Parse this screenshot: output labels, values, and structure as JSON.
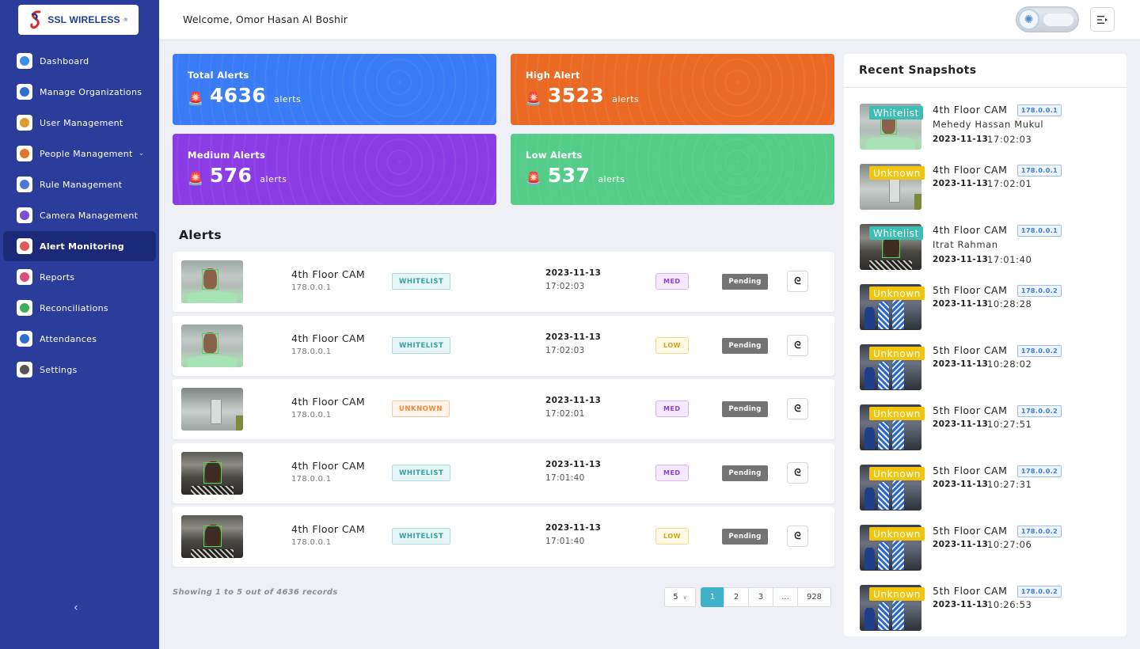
{
  "brand": {
    "logo_text": "SSL WIRELESS",
    "logo_mark": "®"
  },
  "sidebar": {
    "items": [
      {
        "label": "Dashboard",
        "icon": "dashboard-icon",
        "color": "#3a8ee6",
        "active": false
      },
      {
        "label": "Manage Organizations",
        "icon": "building-icon",
        "color": "#2f6fd0",
        "active": false
      },
      {
        "label": "User Management",
        "icon": "user-icon",
        "color": "#e29a2b",
        "active": false
      },
      {
        "label": "People Management",
        "icon": "people-icon",
        "color": "#e0762a",
        "active": false,
        "has_caret": true
      },
      {
        "label": "Rule Management",
        "icon": "rules-icon",
        "color": "#4c79d8",
        "active": false
      },
      {
        "label": "Camera Management",
        "icon": "camera-icon",
        "color": "#7b4fd4",
        "active": false
      },
      {
        "label": "Alert Monitoring",
        "icon": "alert-icon",
        "color": "#e05a5a",
        "active": true
      },
      {
        "label": "Reports",
        "icon": "reports-icon",
        "color": "#d94f7a",
        "active": false
      },
      {
        "label": "Reconciliations",
        "icon": "reconcile-icon",
        "color": "#3fae5a",
        "active": false
      },
      {
        "label": "Attendances",
        "icon": "attendance-icon",
        "color": "#2f6fd0",
        "active": false
      },
      {
        "label": "Settings",
        "icon": "gear-icon",
        "color": "#555555",
        "active": false
      }
    ],
    "collapse_label": "‹"
  },
  "header": {
    "welcome": "Welcome, Omor Hasan Al Boshir",
    "menu_icon": "menu-toggle-icon"
  },
  "stats": [
    {
      "title": "Total Alerts",
      "value": "4636",
      "unit": "alerts",
      "color": "#3a7cf6"
    },
    {
      "title": "High Alert",
      "value": "3523",
      "unit": "alerts",
      "color": "#ea6a25"
    },
    {
      "title": "Medium Alerts",
      "value": "576",
      "unit": "alerts",
      "color": "#8b3ce5"
    },
    {
      "title": "Low Alerts",
      "value": "537",
      "unit": "alerts",
      "color": "#55cc88"
    }
  ],
  "alerts": {
    "title": "Alerts",
    "rows": [
      {
        "camera": "4th Floor CAM",
        "ip": "178.0.0.1",
        "tag": "WHITELIST",
        "date": "2023-11-13",
        "time": "17:02:03",
        "severity": "MED",
        "status": "Pending",
        "thumb": "office"
      },
      {
        "camera": "4th Floor CAM",
        "ip": "178.0.0.1",
        "tag": "WHITELIST",
        "date": "2023-11-13",
        "time": "17:02:03",
        "severity": "LOW",
        "status": "Pending",
        "thumb": "office"
      },
      {
        "camera": "4th Floor CAM",
        "ip": "178.0.0.1",
        "tag": "UNKNOWN",
        "date": "2023-11-13",
        "time": "17:02:01",
        "severity": "MED",
        "status": "Pending",
        "thumb": "wall"
      },
      {
        "camera": "4th Floor CAM",
        "ip": "178.0.0.1",
        "tag": "WHITELIST",
        "date": "2023-11-13",
        "time": "17:01:40",
        "severity": "MED",
        "status": "Pending",
        "thumb": "dark"
      },
      {
        "camera": "4th Floor CAM",
        "ip": "178.0.0.1",
        "tag": "WHITELIST",
        "date": "2023-11-13",
        "time": "17:01:40",
        "severity": "LOW",
        "status": "Pending",
        "thumb": "dark"
      }
    ],
    "action_icon": "detail-icon",
    "records_text": "Showing 1 to 5 out of 4636 records",
    "per_page": "5",
    "pages": [
      "1",
      "2",
      "3",
      "...",
      "928"
    ],
    "current_page": "1"
  },
  "snapshots": {
    "title": "Recent Snapshots",
    "items": [
      {
        "badge": "Whitelist",
        "camera": "4th Floor CAM",
        "ip": "178.0.0.1",
        "person": "Mehedy Hassan Mukul",
        "date": "2023-11-13",
        "time": "17:02:03",
        "thumb": "office"
      },
      {
        "badge": "Unknown",
        "camera": "4th Floor CAM",
        "ip": "178.0.0.1",
        "person": "",
        "date": "2023-11-13",
        "time": "17:02:01",
        "thumb": "wall"
      },
      {
        "badge": "Whitelist",
        "camera": "4th Floor CAM",
        "ip": "178.0.0.1",
        "person": "Itrat Rahman",
        "date": "2023-11-13",
        "time": "17:01:40",
        "thumb": "dark"
      },
      {
        "badge": "Unknown",
        "camera": "5th Floor CAM",
        "ip": "178.0.0.2",
        "person": "",
        "date": "2023-11-13",
        "time": "10:28:28",
        "thumb": "crowd"
      },
      {
        "badge": "Unknown",
        "camera": "5th Floor CAM",
        "ip": "178.0.0.2",
        "person": "",
        "date": "2023-11-13",
        "time": "10:28:02",
        "thumb": "crowd"
      },
      {
        "badge": "Unknown",
        "camera": "5th Floor CAM",
        "ip": "178.0.0.2",
        "person": "",
        "date": "2023-11-13",
        "time": "10:27:51",
        "thumb": "crowd"
      },
      {
        "badge": "Unknown",
        "camera": "5th Floor CAM",
        "ip": "178.0.0.2",
        "person": "",
        "date": "2023-11-13",
        "time": "10:27:31",
        "thumb": "crowd"
      },
      {
        "badge": "Unknown",
        "camera": "5th Floor CAM",
        "ip": "178.0.0.2",
        "person": "",
        "date": "2023-11-13",
        "time": "10:27:06",
        "thumb": "crowd"
      },
      {
        "badge": "Unknown",
        "camera": "5th Floor CAM",
        "ip": "178.0.0.2",
        "person": "",
        "date": "2023-11-13",
        "time": "10:26:53",
        "thumb": "crowd"
      }
    ]
  }
}
